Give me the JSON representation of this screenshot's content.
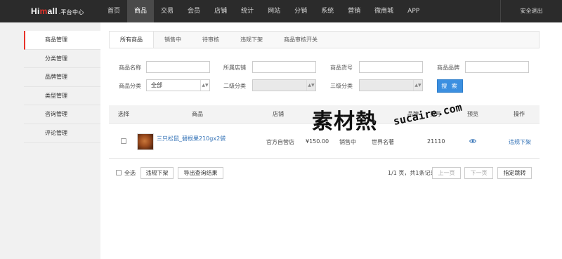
{
  "brand": {
    "logo_prefix": "Hi",
    "logo_mid": "m",
    "logo_suffix": "all",
    "logo_sub": ".平台中心"
  },
  "nav": [
    "首页",
    "商品",
    "交易",
    "会员",
    "店铺",
    "统计",
    "网站",
    "分销",
    "系统",
    "营销",
    "微商城",
    "APP"
  ],
  "nav_active_index": 1,
  "logout_label": "安全退出",
  "sidebar": {
    "items": [
      "商品管理",
      "分类管理",
      "品牌管理",
      "类型管理",
      "咨询管理",
      "评论管理"
    ],
    "active_index": 0
  },
  "tabs": [
    "所有商品",
    "销售中",
    "待审核",
    "违规下架",
    "商品审核开关"
  ],
  "filters": {
    "name_label": "商品名称",
    "shop_label": "所属店铺",
    "sku_label": "商品货号",
    "brand_label": "商品品牌",
    "cat1_label": "商品分类",
    "cat1_value": "全部",
    "cat2_label": "二级分类",
    "cat3_label": "三级分类",
    "search_label": "搜 索"
  },
  "table": {
    "headers": {
      "select": "选择",
      "product": "商品",
      "shop": "店铺",
      "brand": "品牌",
      "sku": "货号",
      "preview": "预览",
      "action": "操作"
    },
    "rows": [
      {
        "name": "三只松鼠_碧根果210gx2袋",
        "shop": "官方自营店",
        "price": "¥150.00",
        "status": "销售中",
        "brand": "世界名著",
        "sku": "21110",
        "action": "违规下架"
      }
    ]
  },
  "footer": {
    "select_all": "全选",
    "takedown": "违规下架",
    "export": "导出查询结果",
    "page_info": "1/1 页，共1条记录",
    "prev": "上一页",
    "next": "下一页",
    "jump": "指定跳转"
  },
  "watermark": {
    "main": "素材熱",
    "url": "sucaire.com"
  },
  "colors": {
    "accent_red": "#e8332a",
    "link_blue": "#2f6fb5",
    "search_blue": "#3b8fe0",
    "topbar": "#2b2b2b"
  }
}
